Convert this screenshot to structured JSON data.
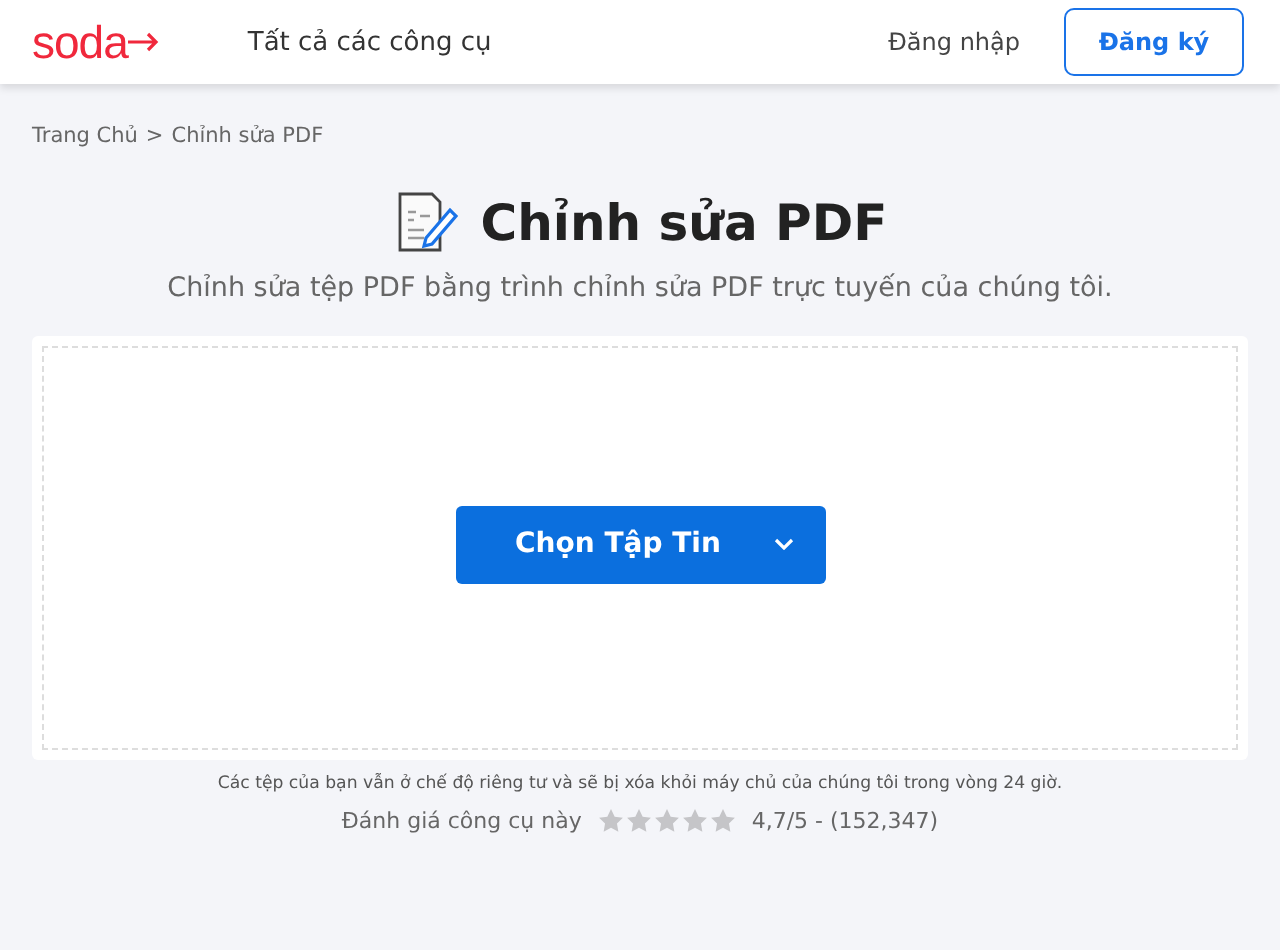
{
  "header": {
    "logo": "soda",
    "nav_link": "Tất cả các công cụ",
    "login": "Đăng nhập",
    "signup": "Đăng ký"
  },
  "breadcrumb": {
    "home": "Trang Chủ",
    "separator": ">",
    "current": "Chỉnh sửa PDF"
  },
  "title": "Chỉnh sửa PDF",
  "subtitle": "Chỉnh sửa tệp PDF bằng trình chỉnh sửa PDF trực tuyến của chúng tôi.",
  "upload": {
    "button": "Chọn Tập Tin"
  },
  "privacy_note": "Các tệp của bạn vẫn ở chế độ riêng tư và sẽ bị xóa khỏi máy chủ của chúng tôi trong vòng 24 giờ.",
  "rating": {
    "label": "Đánh giá công cụ này",
    "stars": 0,
    "score": "4,7/5 - (152,347)"
  }
}
